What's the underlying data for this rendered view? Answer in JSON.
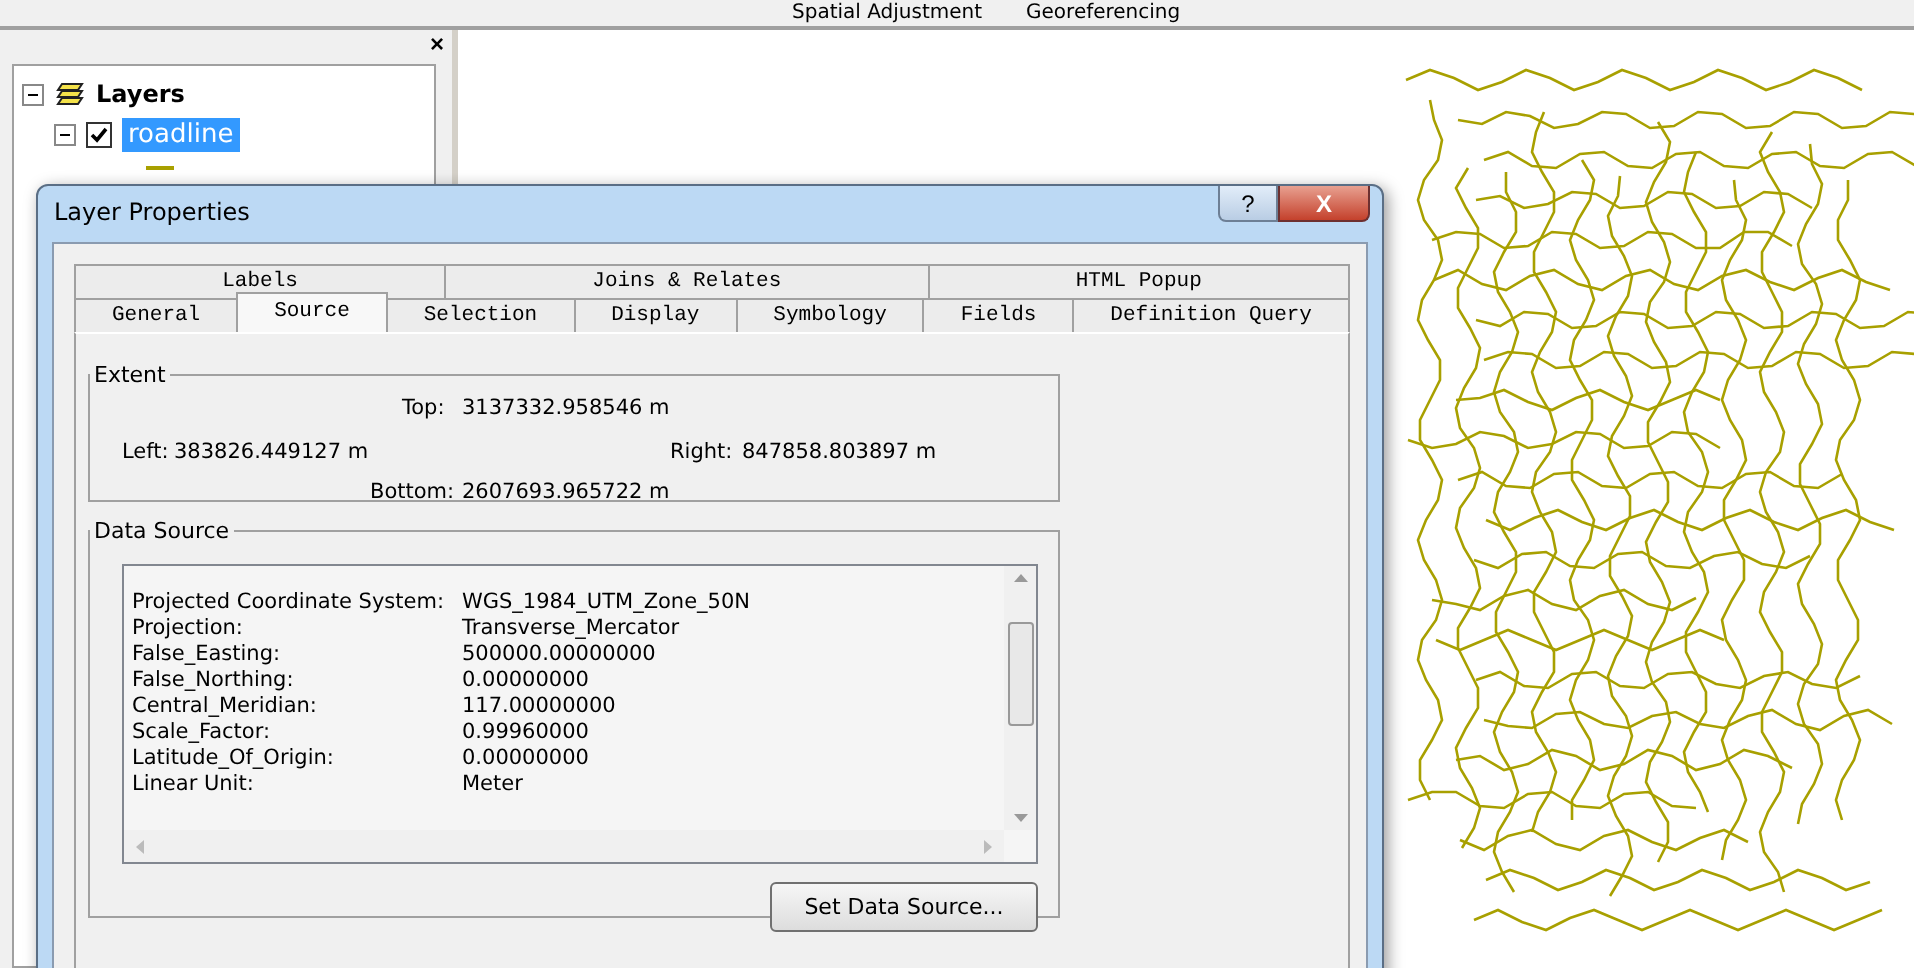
{
  "toolbar": {
    "items": [
      {
        "label": "Spatial Adjustment"
      },
      {
        "label": "Georeferencing"
      }
    ]
  },
  "toc": {
    "close": "×",
    "root": {
      "label": "Layers",
      "expanded": true,
      "children": [
        {
          "label": "roadline",
          "checked": true,
          "selected": true,
          "expanded": true
        }
      ]
    }
  },
  "dialog": {
    "title": "Layer Properties",
    "help": "?",
    "close": "X",
    "tab_rows": [
      [
        {
          "label": "Labels",
          "selected": false
        },
        {
          "label": "Joins & Relates",
          "selected": false
        },
        {
          "label": "HTML Popup",
          "selected": false
        }
      ],
      [
        {
          "label": "General",
          "selected": false
        },
        {
          "label": "Source",
          "selected": true
        },
        {
          "label": "Selection",
          "selected": false
        },
        {
          "label": "Display",
          "selected": false
        },
        {
          "label": "Symbology",
          "selected": false
        },
        {
          "label": "Fields",
          "selected": false
        },
        {
          "label": "Definition Query",
          "selected": false
        }
      ]
    ],
    "extent": {
      "title": "Extent",
      "top_label": "Top:",
      "top": "3137332.958546 m",
      "left_label": "Left:",
      "left": "383826.449127 m",
      "right_label": "Right:",
      "right": "847858.803897 m",
      "bottom_label": "Bottom:",
      "bottom": "2607693.965722 m"
    },
    "data_source": {
      "title": "Data Source",
      "rows": [
        {
          "name": "Projected Coordinate System:",
          "value": "WGS_1984_UTM_Zone_50N"
        },
        {
          "name": "Projection:",
          "value": "Transverse_Mercator"
        },
        {
          "name": "False_Easting:",
          "value": "500000.00000000"
        },
        {
          "name": "False_Northing:",
          "value": "0.00000000"
        },
        {
          "name": "Central_Meridian:",
          "value": "117.00000000"
        },
        {
          "name": "Scale_Factor:",
          "value": "0.99960000"
        },
        {
          "name": "Latitude_Of_Origin:",
          "value": "0.00000000"
        },
        {
          "name": "Linear Unit:",
          "value": "Meter"
        }
      ],
      "button": "Set Data Source..."
    }
  }
}
